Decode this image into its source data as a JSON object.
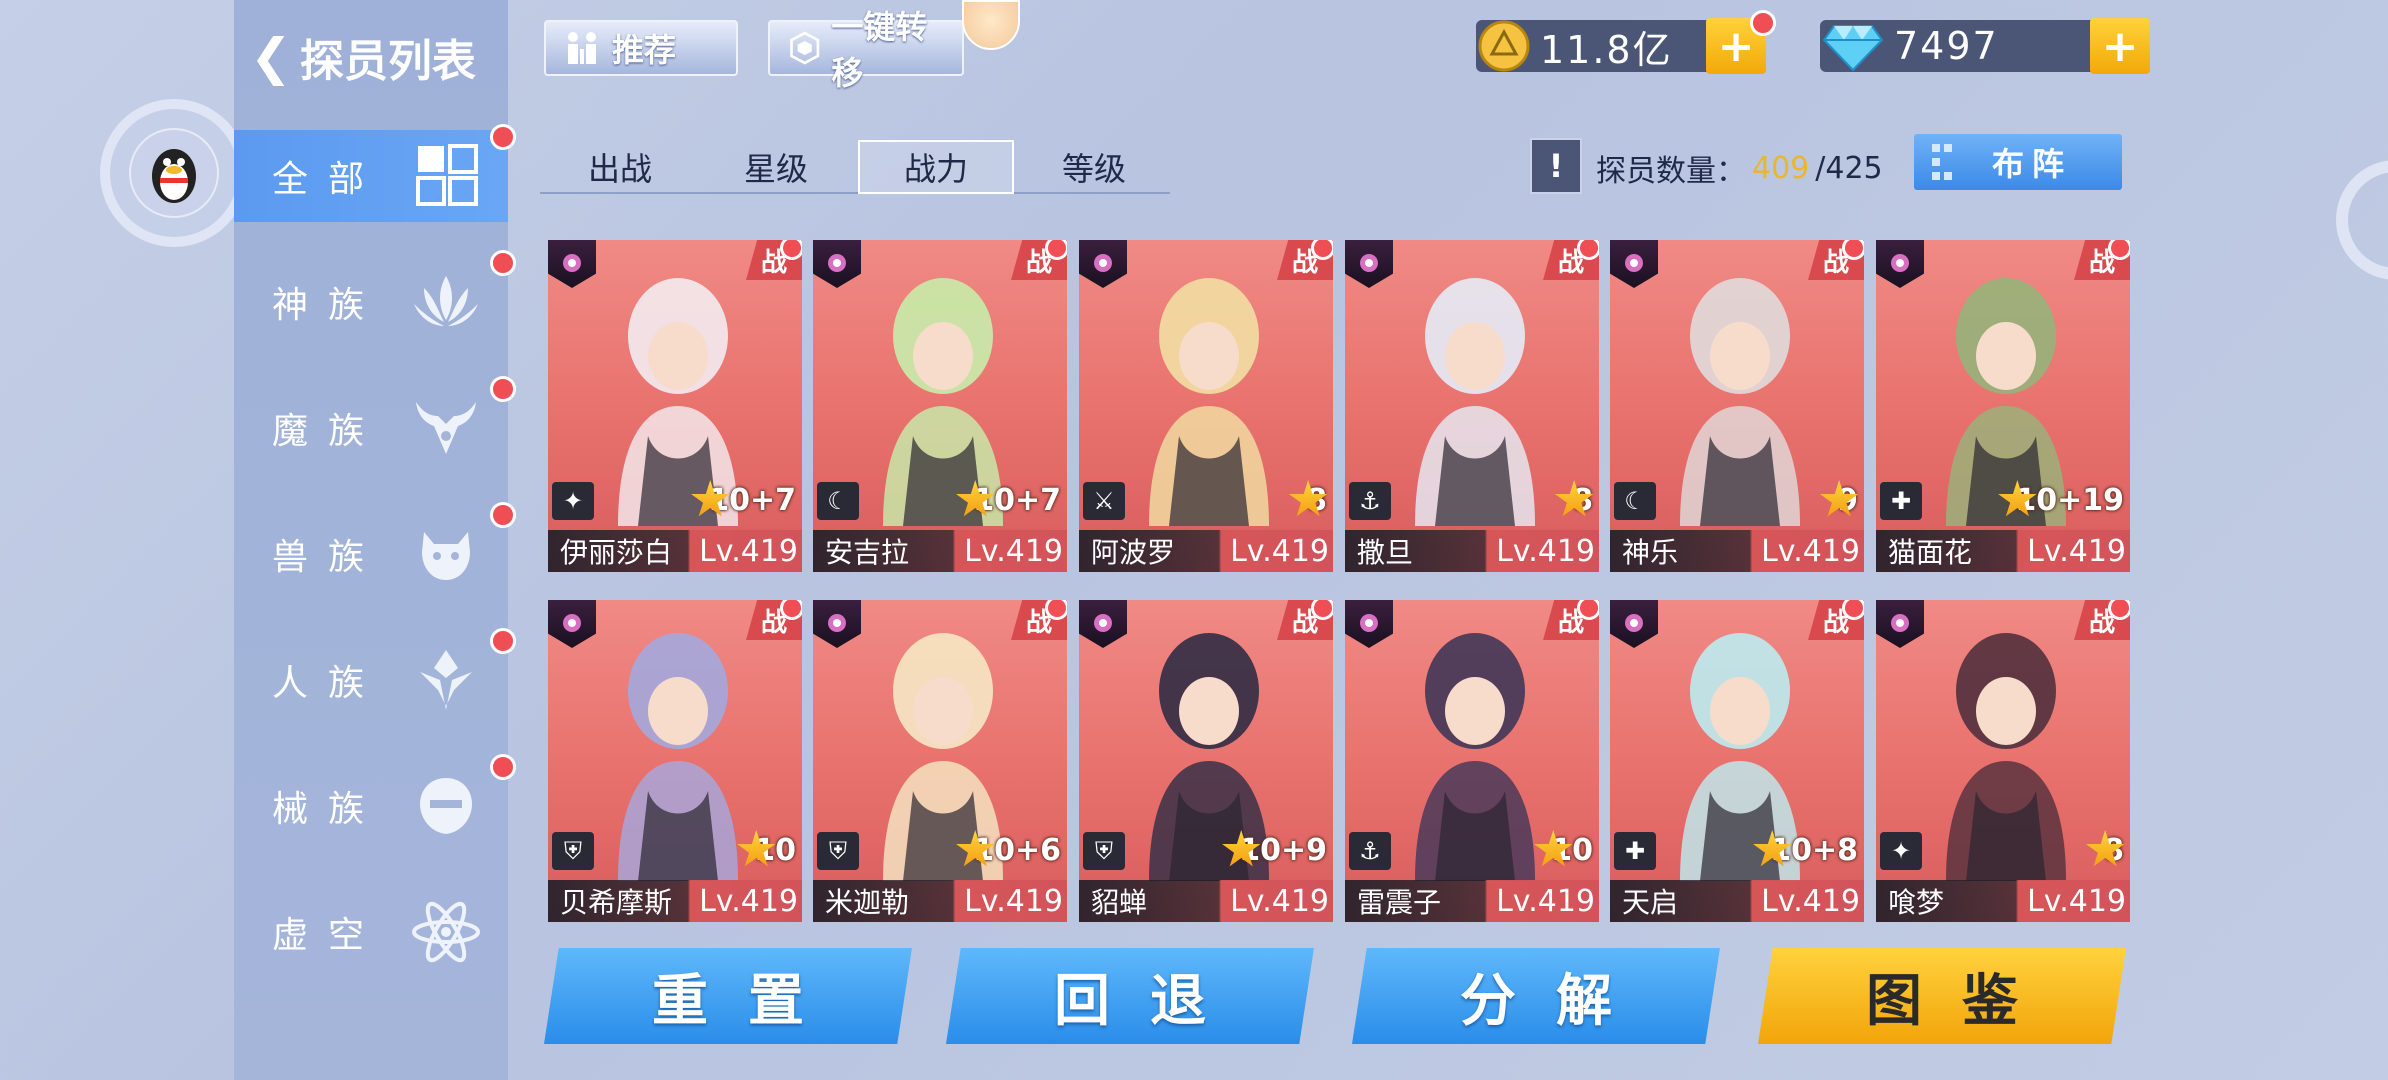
{
  "sidebar": {
    "title": "探员列表",
    "categories": [
      {
        "label": "全部",
        "active": true,
        "icon": "grid-icon",
        "has_dot": true
      },
      {
        "label": "神族",
        "active": false,
        "icon": "lotus-icon",
        "has_dot": true
      },
      {
        "label": "魔族",
        "active": false,
        "icon": "demon-horns-icon",
        "has_dot": true
      },
      {
        "label": "兽族",
        "active": false,
        "icon": "beast-head-icon",
        "has_dot": true
      },
      {
        "label": "人族",
        "active": false,
        "icon": "human-emblem-icon",
        "has_dot": true
      },
      {
        "label": "械族",
        "active": false,
        "icon": "mech-head-icon",
        "has_dot": true
      },
      {
        "label": "虚空",
        "active": false,
        "icon": "atom-icon",
        "has_dot": false
      }
    ]
  },
  "toolbar": {
    "recommend_label": "推荐",
    "transfer_label": "一键转移"
  },
  "currency": {
    "gold": "11.8亿",
    "diamond": "7497"
  },
  "tabs": [
    {
      "label": "出战",
      "active": false
    },
    {
      "label": "星级",
      "active": false
    },
    {
      "label": "战力",
      "active": true
    },
    {
      "label": "等级",
      "active": false
    }
  ],
  "agent_count": {
    "info_label": "!",
    "label": "探员数量：",
    "current": "409",
    "max": "/425"
  },
  "formation_label": "布阵",
  "cards": [
    {
      "name": "伊丽莎白",
      "level": "Lv.419",
      "stars": "10+7",
      "tag": "战"
    },
    {
      "name": "安吉拉",
      "level": "Lv.419",
      "stars": "10+7",
      "tag": "战"
    },
    {
      "name": "阿波罗",
      "level": "Lv.419",
      "stars": "8",
      "tag": "战"
    },
    {
      "name": "撒旦",
      "level": "Lv.419",
      "stars": "8",
      "tag": "战"
    },
    {
      "name": "神乐",
      "level": "Lv.419",
      "stars": "9",
      "tag": "战"
    },
    {
      "name": "猫面花",
      "level": "Lv.419",
      "stars": "10+19",
      "tag": "战"
    },
    {
      "name": "贝希摩斯",
      "level": "Lv.419",
      "stars": "10",
      "tag": "战"
    },
    {
      "name": "米迦勒",
      "level": "Lv.419",
      "stars": "10+6",
      "tag": "战"
    },
    {
      "name": "貂蝉",
      "level": "Lv.419",
      "stars": "10+9",
      "tag": "战"
    },
    {
      "name": "雷震子",
      "level": "Lv.419",
      "stars": "10",
      "tag": "战"
    },
    {
      "name": "天启",
      "level": "Lv.419",
      "stars": "10+8",
      "tag": "战"
    },
    {
      "name": "喰梦",
      "level": "Lv.419",
      "stars": "8",
      "tag": "战"
    }
  ],
  "bottom_buttons": {
    "reset": "重置",
    "rollback": "回退",
    "decompose": "分解",
    "codex": "图鉴"
  },
  "colors": {
    "accent_blue": "#3b8ae8",
    "gold": "#f2a90a",
    "card_bg": "#e8706c",
    "red_dot": "#f04e55"
  }
}
